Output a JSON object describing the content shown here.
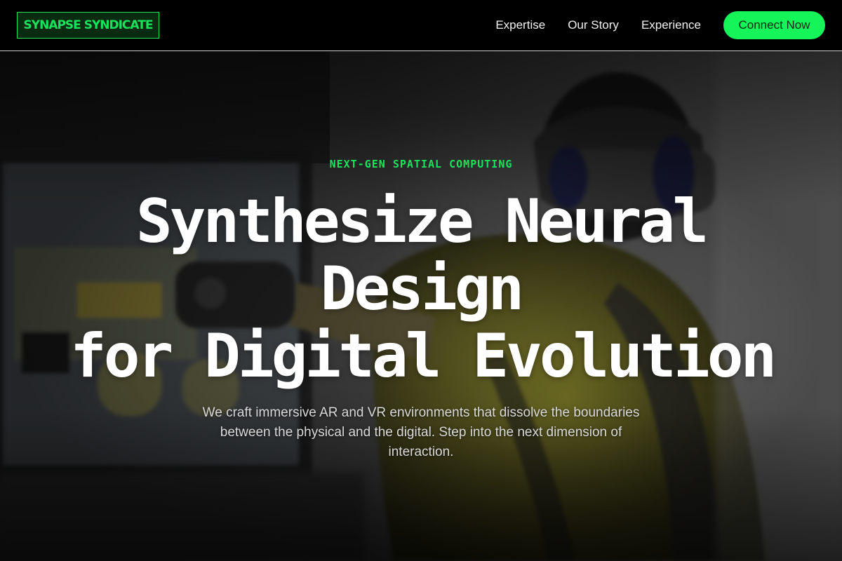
{
  "header": {
    "logo": "SYNAPSE SYNDICATE",
    "nav": [
      "Expertise",
      "Our Story",
      "Experience"
    ],
    "cta": "Connect Now"
  },
  "hero": {
    "eyebrow": "NEXT-GEN SPATIAL COMPUTING",
    "headline_lines": [
      "Synthesize Neural",
      "Design",
      "for Digital Evolution"
    ],
    "subtext": "We craft immersive AR and VR environments that dissolve the boundaries between the physical and the digital. Step into the next dimension of interaction."
  },
  "colors": {
    "accent": "#15f55a",
    "background": "#000000",
    "text": "#ffffff"
  }
}
